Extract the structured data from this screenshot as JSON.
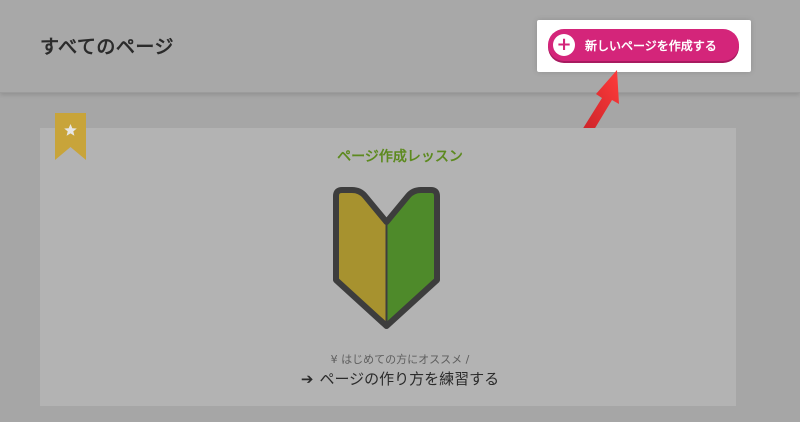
{
  "header": {
    "title": "すべてのページ",
    "create_button_label": "新しいページを作成する",
    "plus_icon": "+"
  },
  "lesson": {
    "title": "ページ作成レッスン",
    "subtitle": "¥ はじめての方にオススメ /",
    "link_arrow": "➔",
    "link_label": "ページの作り方を練習する"
  },
  "colors": {
    "accent": "#d4257a",
    "highlight_arrow": "#e8242c",
    "lesson_title": "#5d8a1f",
    "ribbon": "#c8a43a",
    "mark_left": "#a7922f",
    "mark_right": "#4e8a2a"
  },
  "icons": {
    "ribbon": "bookmark-star-icon",
    "mark": "beginner-mark-icon",
    "arrow": "arrow-right-icon"
  }
}
